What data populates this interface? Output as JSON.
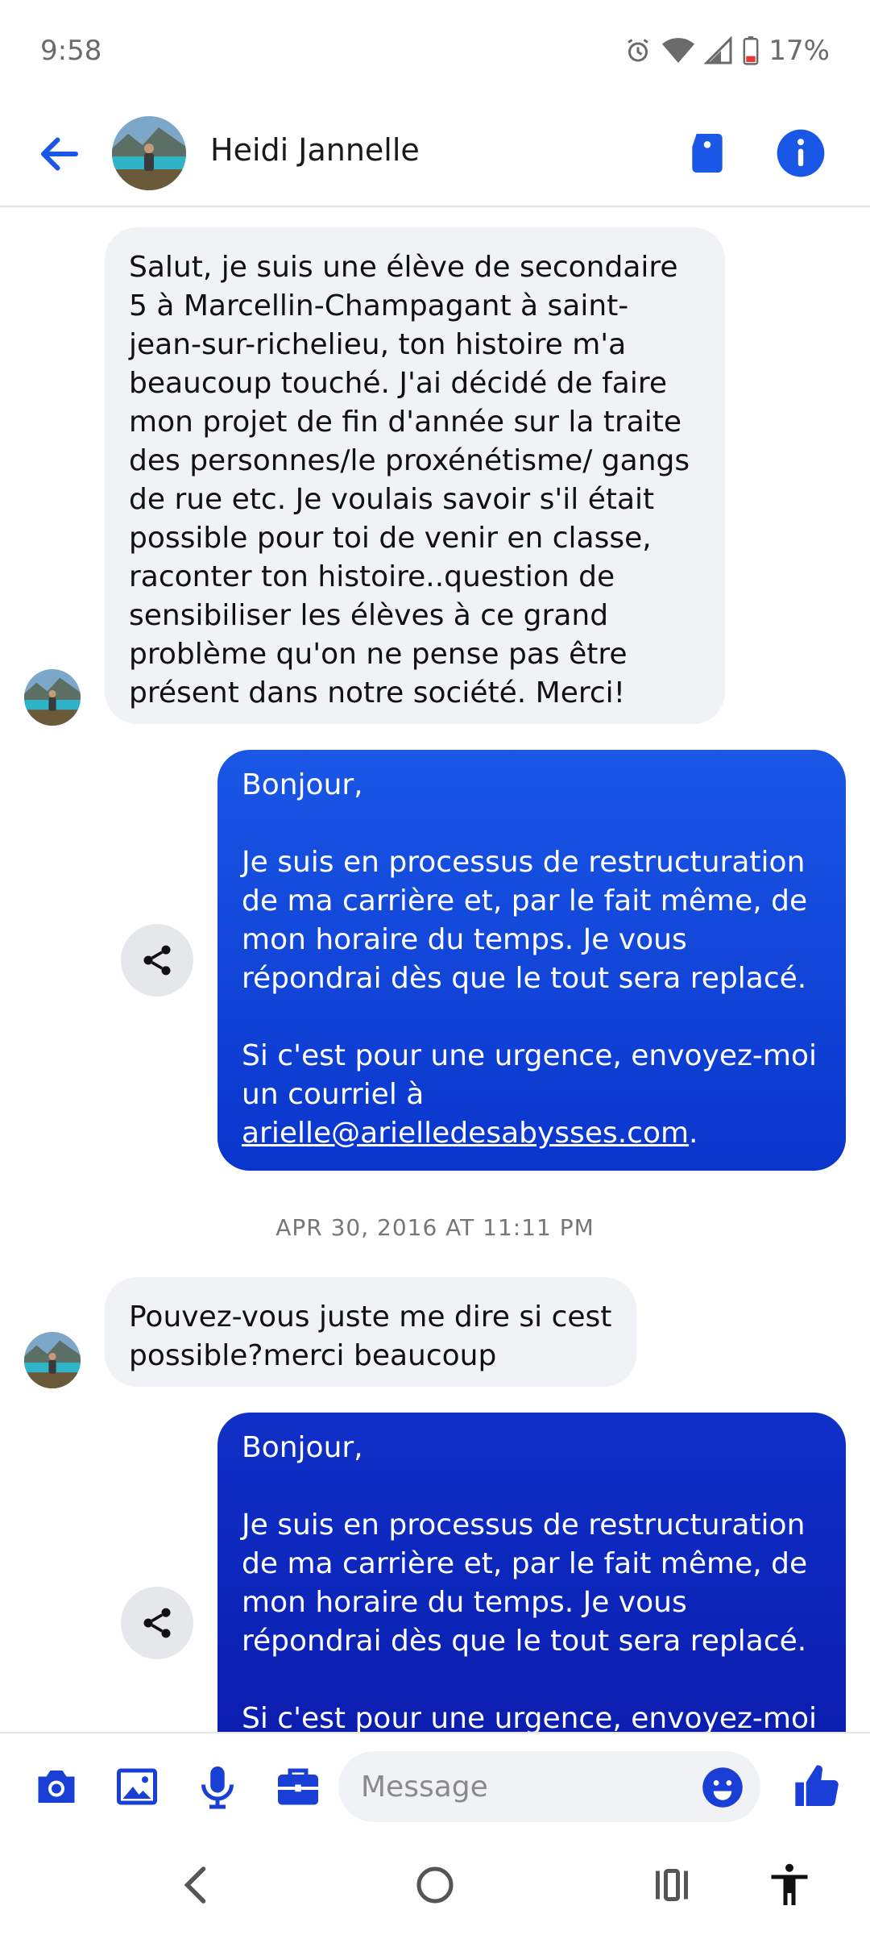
{
  "status_bar": {
    "time": "9:58",
    "battery": "17%"
  },
  "header": {
    "contact_name": "Heidi Jannelle"
  },
  "messages": [
    {
      "dir": "in",
      "text": "Salut, je suis une élève de secondaire 5 à Marcellin-Champagant à saint-jean-sur-richelieu, ton histoire m'a beaucoup touché. J'ai décidé de faire mon projet de fin d'année sur la traite des personnes/le proxénétisme/ gangs de rue etc. Je voulais savoir s'il était possible pour toi de venir en classe, raconter ton histoire..question de sensibiliser les élèves à ce grand problème qu'on ne pense pas être présent dans notre société. Merci!"
    },
    {
      "dir": "out",
      "text": "Bonjour,\n\nJe suis en processus de restructuration de ma carrière et, par le fait même, de mon horaire du temps. Je vous répondrai dès que le tout sera replacé.\n\nSi c'est pour une urgence, envoyez-moi un courriel à ",
      "link": "arielle@arielledesabysses.com",
      "trail": "."
    },
    {
      "dir": "in",
      "text": "Pouvez-vous juste me dire si cest possible?merci beaucoup"
    },
    {
      "dir": "out",
      "text": "Bonjour,\n\nJe suis en processus de restructuration de ma carrière et, par le fait même, de mon horaire du temps. Je vous répondrai dès que le tout sera replacé.\n\nSi c'est pour une urgence, envoyez-moi"
    }
  ],
  "timestamp": "APR 30, 2016 AT 11:11 PM",
  "composer": {
    "placeholder": "Message"
  },
  "colors": {
    "accent": "#1a57e6",
    "bubble_out_top": "#1a57e6",
    "bubble_out_bottom": "#0a22b8",
    "bubble_in": "#f1f2f6"
  },
  "icons": [
    "back-arrow-icon",
    "tag-icon",
    "info-icon",
    "share-icon",
    "camera-icon",
    "image-icon",
    "microphone-icon",
    "briefcase-icon",
    "emoji-icon",
    "thumbs-up-icon",
    "nav-back-icon",
    "nav-home-icon",
    "nav-recents-icon",
    "accessibility-icon"
  ]
}
